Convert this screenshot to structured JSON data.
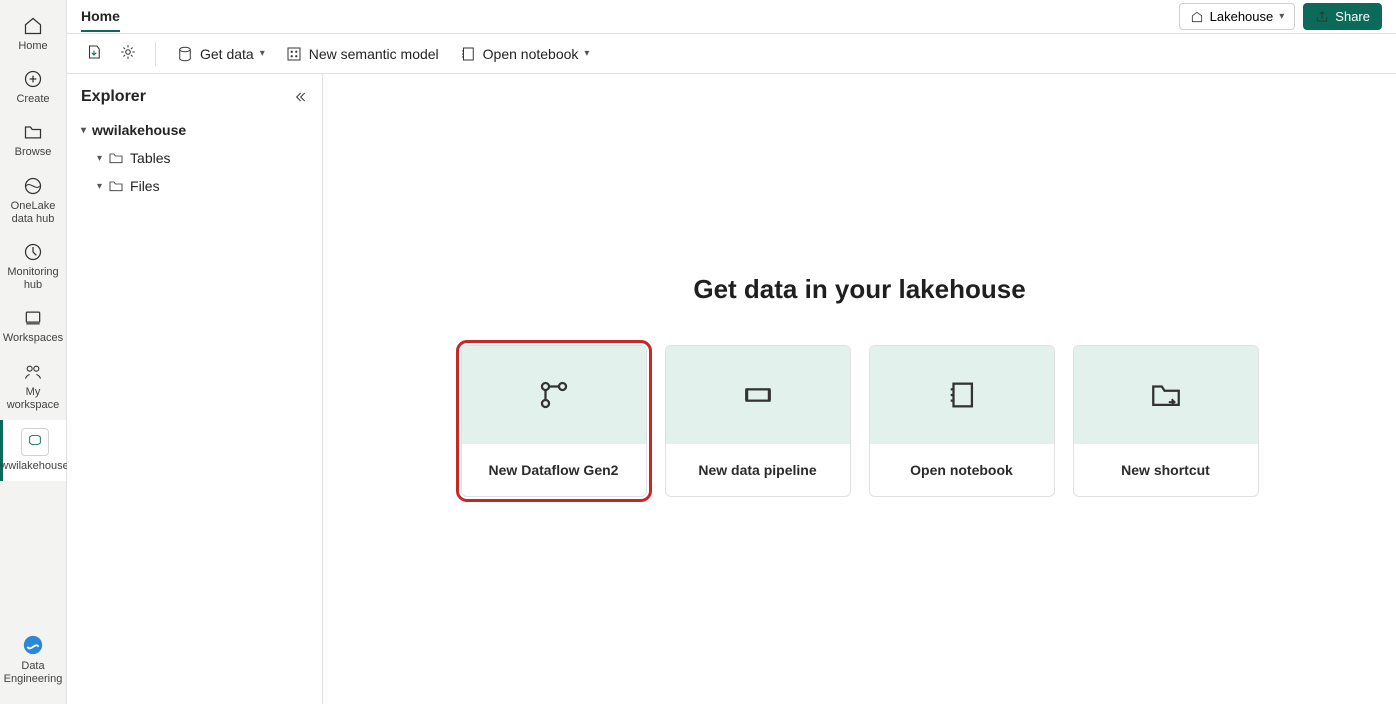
{
  "leftnav": {
    "home": "Home",
    "create": "Create",
    "browse": "Browse",
    "onelake": "OneLake data hub",
    "monitoring": "Monitoring hub",
    "workspaces": "Workspaces",
    "myworkspace": "My workspace",
    "wwilakehouse": "wwilakehouse",
    "dataeng": "Data Engineering"
  },
  "header": {
    "tab": "Home",
    "lakehouse_label": "Lakehouse",
    "share_label": "Share"
  },
  "toolbar": {
    "get_data": "Get data",
    "new_semantic": "New semantic model",
    "open_notebook": "Open notebook"
  },
  "explorer": {
    "title": "Explorer",
    "root": "wwilakehouse",
    "tables": "Tables",
    "files": "Files"
  },
  "main": {
    "heading": "Get data in your lakehouse",
    "cards": {
      "dataflow": "New Dataflow Gen2",
      "pipeline": "New data pipeline",
      "notebook": "Open notebook",
      "shortcut": "New shortcut"
    }
  }
}
